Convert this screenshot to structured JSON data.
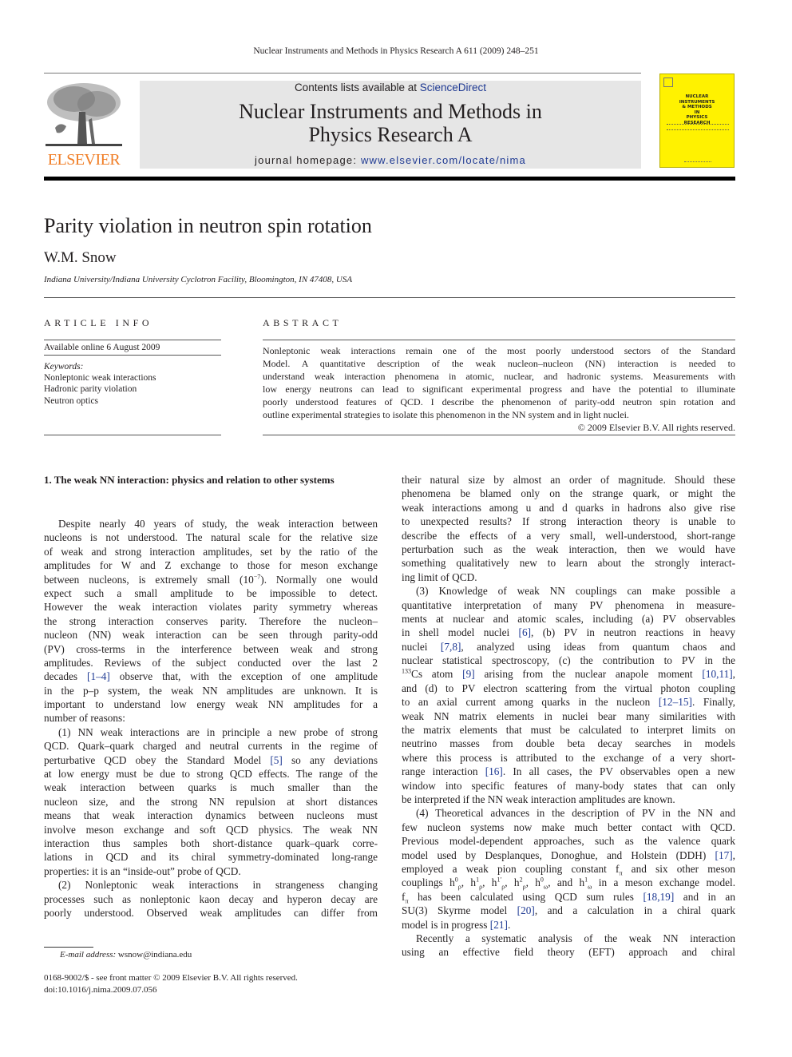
{
  "header": {
    "running_head": "Nuclear Instruments and Methods in Physics Research A 611 (2009) 248–251",
    "publisher_logo": "ELSEVIER",
    "contents_prefix": "Contents lists available at ",
    "contents_link": "ScienceDirect",
    "journal_title_line1": "Nuclear Instruments and Methods in",
    "journal_title_line2": "Physics Research A",
    "homepage_prefix": "journal homepage: ",
    "homepage_url": "www.elsevier.com/locate/nima",
    "cover_text": [
      "NUCLEAR",
      "INSTRUMENTS",
      "& METHODS",
      "IN",
      "PHYSICS",
      "RESEARCH"
    ],
    "colors": {
      "link": "#1f3a93",
      "elsevier_orange": "#f07e26",
      "cover_yellow": "#fff200",
      "masthead_gray": "#e6e6e6"
    }
  },
  "article": {
    "title": "Parity violation in neutron spin rotation",
    "author": "W.M. Snow",
    "affiliation": "Indiana University/Indiana University Cyclotron Facility, Bloomington, IN 47408, USA"
  },
  "article_info": {
    "heading": "ARTICLE INFO",
    "available_online": "Available online 6 August 2009",
    "keywords_label": "Keywords:",
    "keywords": [
      "Nonleptonic weak interactions",
      "Hadronic parity violation",
      "Neutron optics"
    ]
  },
  "abstract": {
    "heading": "ABSTRACT",
    "lines": [
      "Nonleptonic weak interactions remain one of the most poorly understood sectors of the Standard",
      "Model. A quantitative description of the weak nucleon–nucleon (NN) interaction is needed to",
      "understand weak interaction phenomena in atomic, nuclear, and hadronic systems. Measurements with",
      "low energy neutrons can lead to significant experimental progress and have the potential to illuminate",
      "poorly understood features of QCD. I describe the phenomenon of parity-odd neutron spin rotation and",
      "outline experimental strategies to isolate this phenomenon in the NN system and in light nuclei."
    ],
    "copyright": "© 2009 Elsevier B.V. All rights reserved."
  },
  "section1": {
    "heading": "1.  The weak NN interaction: physics and relation to other systems",
    "left_column": [
      "Despite nearly 40 years of study, the weak interaction between",
      "nucleons is not understood. The natural scale for the relative size",
      "of weak and strong interaction amplitudes, set by the ratio of the",
      "amplitudes for W and Z exchange to those for meson exchange",
      "between nucleons, is extremely small (10",
      "expect such a small amplitude to be impossible to detect.",
      "However the weak interaction violates parity symmetry whereas",
      "the strong interaction conserves parity. Therefore the nucleon–",
      "nucleon (NN) weak interaction can be seen through parity-odd",
      "(PV) cross-terms in the interference between weak and strong",
      "amplitudes. Reviews of the subject conducted over the last 2",
      "decades ",
      "in the p–p system, the weak NN amplitudes are unknown. It is",
      "important to understand low energy weak NN amplitudes for a",
      "number of reasons:",
      "(1) NN weak interactions are in principle a new probe of strong",
      "QCD. Quark–quark charged and neutral currents in the regime of",
      "perturbative QCD obey the Standard Model ",
      "at low energy must be due to strong QCD effects. The range of the",
      "weak interaction between quarks is much smaller than the",
      "nucleon size, and the strong NN repulsion at short distances",
      "means that weak interaction dynamics between nucleons must",
      "involve meson exchange and soft QCD physics. The weak NN",
      "interaction thus samples both short-distance quark–quark corre-",
      "lations in QCD and its chiral symmetry-dominated long-range",
      "properties: it is an “inside-out” probe of QCD.",
      "(2) Nonleptonic weak interactions in strangeness changing",
      "processes such as nonleptonic kaon decay and hyperon decay are",
      "poorly understood. Observed weak amplitudes can differ from"
    ],
    "left_fragments": {
      "exponent": "−7",
      "line5_tail": "). Normally one would",
      "ref_1_4": "[1–4]",
      "line12_tail": " observe that, with the exception of one amplitude",
      "ref_5": "[5]",
      "line18_tail": " so any deviations"
    },
    "right_column": [
      "their natural size by almost an order of magnitude. Should these",
      "phenomena be blamed only on the strange quark, or might the",
      "weak interactions among u and d quarks in hadrons also give rise",
      "to unexpected results? If strong interaction theory is unable to",
      "describe the effects of a very small, well-understood, short-range",
      "perturbation such as the weak interaction, then we would have",
      "something qualitatively new to learn about the strongly interact-",
      "ing limit of QCD.",
      "(3) Knowledge of weak NN couplings can make possible a",
      "quantitative interpretation of many PV phenomena in measure-",
      "ments at nuclear and atomic scales, including (a) PV observables",
      "nuclear statistical spectroscopy, (c) the contribution to PV in the",
      "and (d) to PV electron scattering from the virtual photon coupling",
      "weak NN matrix elements in nuclei bear many similarities with",
      "the matrix elements that must be calculated to interpret limits on",
      "neutrino masses from double beta decay searches in models",
      "where this process is attributed to the exchange of a very short-",
      "window into specific features of many-body states that can only",
      "be interpreted if the NN weak interaction amplitudes are known.",
      "(4) Theoretical advances in the description of PV in the NN and",
      "few nucleon systems now make much better contact with QCD.",
      "Previous model-dependent approaches, such as the valence quark",
      "Recently a systematic analysis of the weak NN interaction",
      "using an effective field theory (EFT) approach and chiral"
    ],
    "right_fragments": {
      "r12a": "in shell model nuclei ",
      "ref_6": "[6]",
      "r12b": ", (b) PV in neutron reactions in heavy",
      "r13a": "nuclei ",
      "ref_7_8": "[7,8]",
      "r13b": ", analyzed using ideas from quantum chaos and",
      "cs_mass": "133",
      "r15a": "Cs atom ",
      "ref_9": "[9]",
      "r15b": " arising from the nuclear anapole moment ",
      "ref_10_11": "[10,11]",
      "r15c": ",",
      "r17a": "to an axial current among quarks in the nucleon ",
      "ref_12_15": "[12–15]",
      "r17b": ". Finally,",
      "r22a": "range interaction ",
      "ref_16": "[16]",
      "r22b": ". In all cases, the PV observables open a new",
      "r28a": "model used by Desplanques, Donoghue, and Holstein (DDH) ",
      "ref_17": "[17]",
      "r28b": ",",
      "r29a": "employed a weak pion coupling constant f",
      "pi": "π",
      "r29b": " and six other meson",
      "r30a": "couplings h",
      "r30b": "in a meson exchange model.",
      "r31a": " has been calculated using QCD sum rules ",
      "ref_18_19": "[18,19]",
      "r31b": " and in an",
      "r32a": "SU(3) Skyrme model ",
      "ref_20": "[20]",
      "r32b": ", and a calculation in a chiral quark",
      "r33a": "model is in progress ",
      "ref_21": "[21]",
      "r33b": ".",
      "rho": "ρ",
      "omega": "ω",
      "and": "and"
    }
  },
  "footnote": {
    "email_label": "E-mail address:",
    "email": "wsnow@indiana.edu"
  },
  "front_matter": {
    "line1": "0168-9002/$ - see front matter © 2009 Elsevier B.V. All rights reserved.",
    "doi": "doi:10.1016/j.nima.2009.07.056"
  }
}
